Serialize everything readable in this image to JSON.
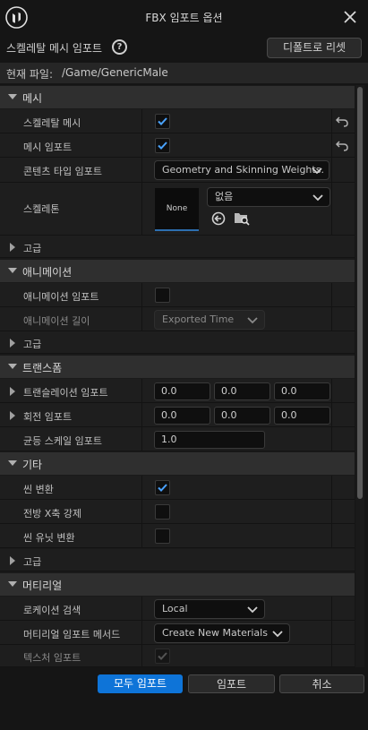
{
  "window": {
    "title": "FBX 임포트 옵션"
  },
  "header": {
    "title": "스켈레탈 메시 임포트",
    "help_glyph": "?",
    "reset_label": "디폴트로 리셋"
  },
  "file": {
    "label": "현재 파일:",
    "path": "/Game/GenericMale"
  },
  "mesh": {
    "category": "메시",
    "skeletal_mesh_label": "스켈레탈 메시",
    "skeletal_mesh_checked": true,
    "import_mesh_label": "메시 임포트",
    "import_mesh_checked": true,
    "content_type_label": "콘텐츠 타입 임포트",
    "content_type_value": "Geometry and Skinning Weights.",
    "skeleton_label": "스켈레톤",
    "skeleton_thumb": "None",
    "skeleton_value": "없음",
    "advanced_label": "고급"
  },
  "animation": {
    "category": "애니메이션",
    "import_label": "애니메이션 임포트",
    "import_checked": false,
    "length_label": "애니메이션 길이",
    "length_value": "Exported Time",
    "advanced_label": "고급"
  },
  "transform": {
    "category": "트랜스폼",
    "translation_label": "트랜슬레이션 임포트",
    "translation": [
      "0.0",
      "0.0",
      "0.0"
    ],
    "rotation_label": "회전 임포트",
    "rotation": [
      "0.0",
      "0.0",
      "0.0"
    ],
    "uniform_scale_label": "균등 스케일 임포트",
    "uniform_scale": "1.0"
  },
  "misc": {
    "category": "기타",
    "convert_scene_label": "씬 변환",
    "convert_scene_checked": true,
    "force_front_x_label": "전방 X축 강제",
    "force_front_x_checked": false,
    "convert_unit_label": "씬 유닛 변환",
    "convert_unit_checked": false,
    "advanced_label": "고급"
  },
  "material": {
    "category": "머티리얼",
    "search_location_label": "로케이션 검색",
    "search_location_value": "Local",
    "import_method_label": "머티리얼 임포트 메서드",
    "import_method_value": "Create New Materials",
    "import_textures_label": "텍스처 임포트",
    "import_textures_checked": true
  },
  "footer": {
    "import_all": "모두 임포트",
    "import": "임포트",
    "cancel": "취소"
  },
  "colors": {
    "accent": "#0e74d8",
    "background": "#151515",
    "category": "#2f2f2f"
  }
}
